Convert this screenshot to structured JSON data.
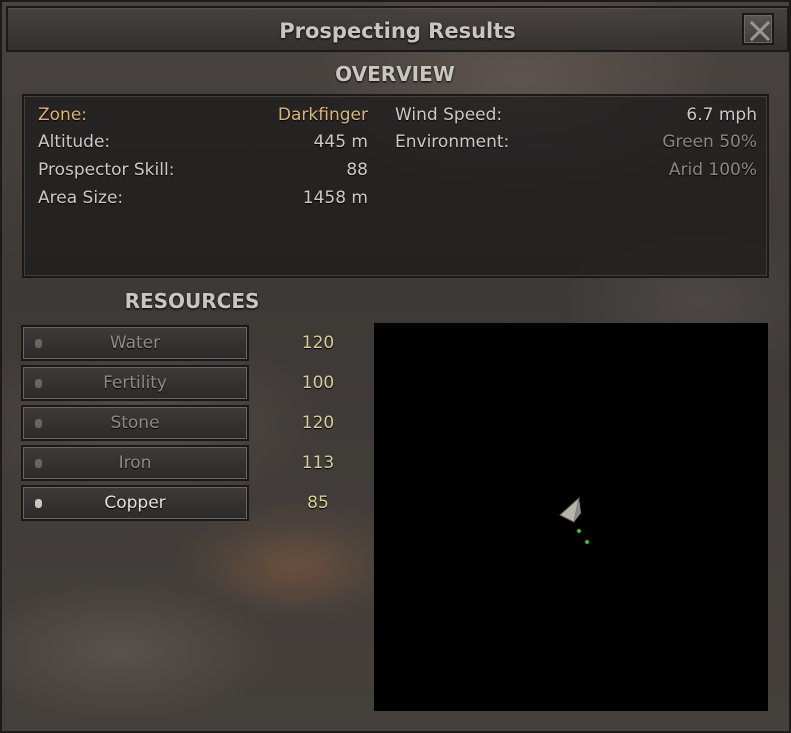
{
  "window": {
    "title": "Prospecting Results"
  },
  "overview": {
    "title": "OVERVIEW",
    "left": [
      {
        "label": "Zone:",
        "value": "Darkfinger"
      },
      {
        "label": "Altitude:",
        "value": "445 m"
      },
      {
        "label": "Prospector Skill:",
        "value": "88"
      },
      {
        "label": "Area Size:",
        "value": "1458 m"
      }
    ],
    "right": [
      {
        "label": "Wind Speed:",
        "value": "6.7 mph"
      },
      {
        "label": "Environment:",
        "value": "Green 50%"
      },
      {
        "label": "",
        "value": "Arid 100%"
      }
    ]
  },
  "resources": {
    "title": "RESOURCES",
    "items": [
      {
        "label": "Water",
        "value": "120",
        "active": false
      },
      {
        "label": "Fertility",
        "value": "100",
        "active": false
      },
      {
        "label": "Stone",
        "value": "120",
        "active": false
      },
      {
        "label": "Iron",
        "value": "113",
        "active": false
      },
      {
        "label": "Copper",
        "value": "85",
        "active": true
      }
    ]
  },
  "colors": {
    "zone_label": "#e0b070",
    "zone_value": "#d8b878",
    "dim_value": "#8a8682",
    "resource_value": "#d6cf97",
    "map_marker": "#22cc22"
  },
  "icons": {
    "close": "close-icon",
    "player_marker": "player-arrow-icon"
  }
}
